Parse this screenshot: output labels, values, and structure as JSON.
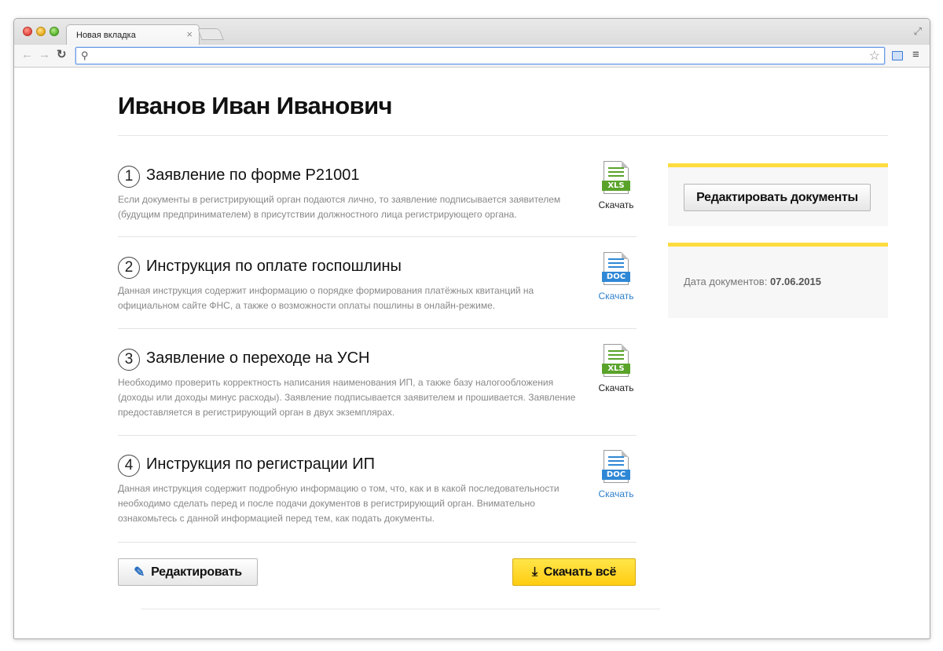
{
  "browser": {
    "tab_title": "Новая вкладка",
    "tab_close": "×",
    "omnibox_value": "",
    "icons": {
      "back": "arrow-left-icon",
      "forward": "arrow-right-icon",
      "reload": "reload-icon",
      "search": "search-icon",
      "star": "star-icon",
      "menu": "hamburger-menu-icon"
    }
  },
  "page": {
    "title": "Иванов Иван Иванович"
  },
  "documents": [
    {
      "number": "1",
      "title": "Заявление по форме Р21001",
      "description": "Если документы в регистрирующий орган подаются лично, то заявление подписывается заявителем (будущим предпринимателем) в присутствии должностного лица регистрирующего органа.",
      "file_type": "XLS",
      "download_label": "Скачать"
    },
    {
      "number": "2",
      "title": "Инструкция по оплате госпошлины",
      "description": "Данная инструкция содержит информацию о порядке формирования платёжных квитанций на официальном сайте ФНС, а также о возможности оплаты пошлины в онлайн-режиме.",
      "file_type": "DOC",
      "download_label": "Скачать"
    },
    {
      "number": "3",
      "title": "Заявление о переходе на УСН",
      "description": "Необходимо проверить корректность написания наименования ИП, а также базу налогообложения (доходы или доходы минус расходы). Заявление подписывается заявителем и прошивается. Заявление предоставляется в регистрирующий орган в двух экземплярах.",
      "file_type": "XLS",
      "download_label": "Скачать"
    },
    {
      "number": "4",
      "title": "Инструкция по регистрации ИП",
      "description": "Данная инструкция содержит подробную информацию о том, что, как и в какой последовательности необходимо сделать перед и после подачи документов в регистрирующий орган. Внимательно ознакомьтесь с данной информацией перед тем, как подать документы.",
      "file_type": "DOC",
      "download_label": "Скачать"
    }
  ],
  "actions": {
    "edit_label": "Редактировать",
    "download_all_label": "Скачать всё"
  },
  "sidebar": {
    "edit_documents_label": "Редактировать документы",
    "date_label": "Дата документов:",
    "date_value": "07.06.2015"
  },
  "colors": {
    "accent_yellow": "#fedc3f",
    "xls_green": "#5aa32a",
    "doc_blue": "#2f88d6",
    "link_xls": "#222222",
    "link_doc": "#2f7fcc"
  }
}
